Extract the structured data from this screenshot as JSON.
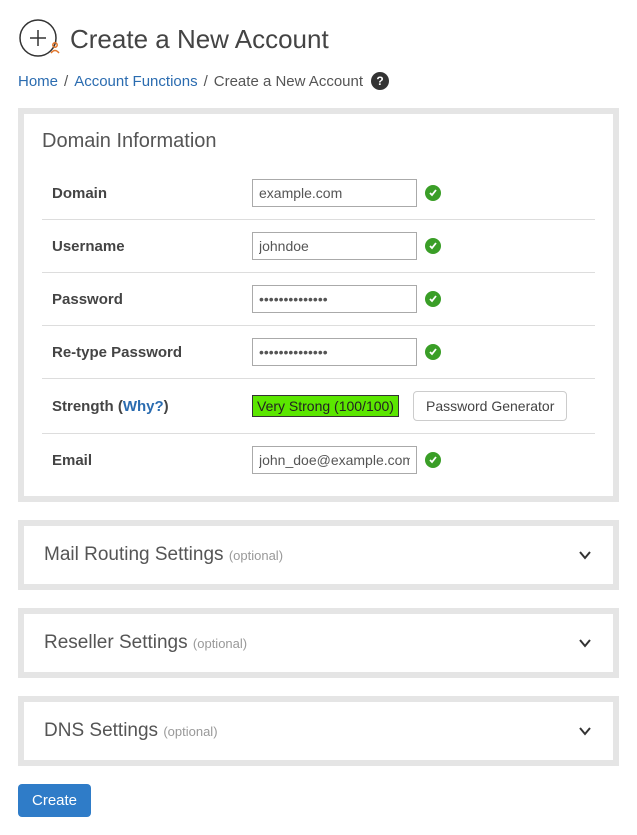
{
  "page": {
    "title": "Create a New Account"
  },
  "breadcrumb": {
    "home": "Home",
    "functions": "Account Functions",
    "current": "Create a New Account"
  },
  "domainInfo": {
    "heading": "Domain Information",
    "labels": {
      "domain": "Domain",
      "username": "Username",
      "password": "Password",
      "retype": "Re-type Password",
      "strength_prefix": "Strength (",
      "strength_link": "Why?",
      "strength_suffix": ")",
      "email": "Email"
    },
    "values": {
      "domain": "example.com",
      "username": "johndoe",
      "password": "..............",
      "retype": "..............",
      "strength": "Very Strong (100/100)",
      "email": "john_doe@example.com"
    },
    "buttons": {
      "password_generator": "Password Generator"
    }
  },
  "sections": {
    "mail": {
      "title": "Mail Routing Settings",
      "optional": "(optional)"
    },
    "reseller": {
      "title": "Reseller Settings",
      "optional": "(optional)"
    },
    "dns": {
      "title": "DNS Settings",
      "optional": "(optional)"
    }
  },
  "actions": {
    "create": "Create"
  }
}
